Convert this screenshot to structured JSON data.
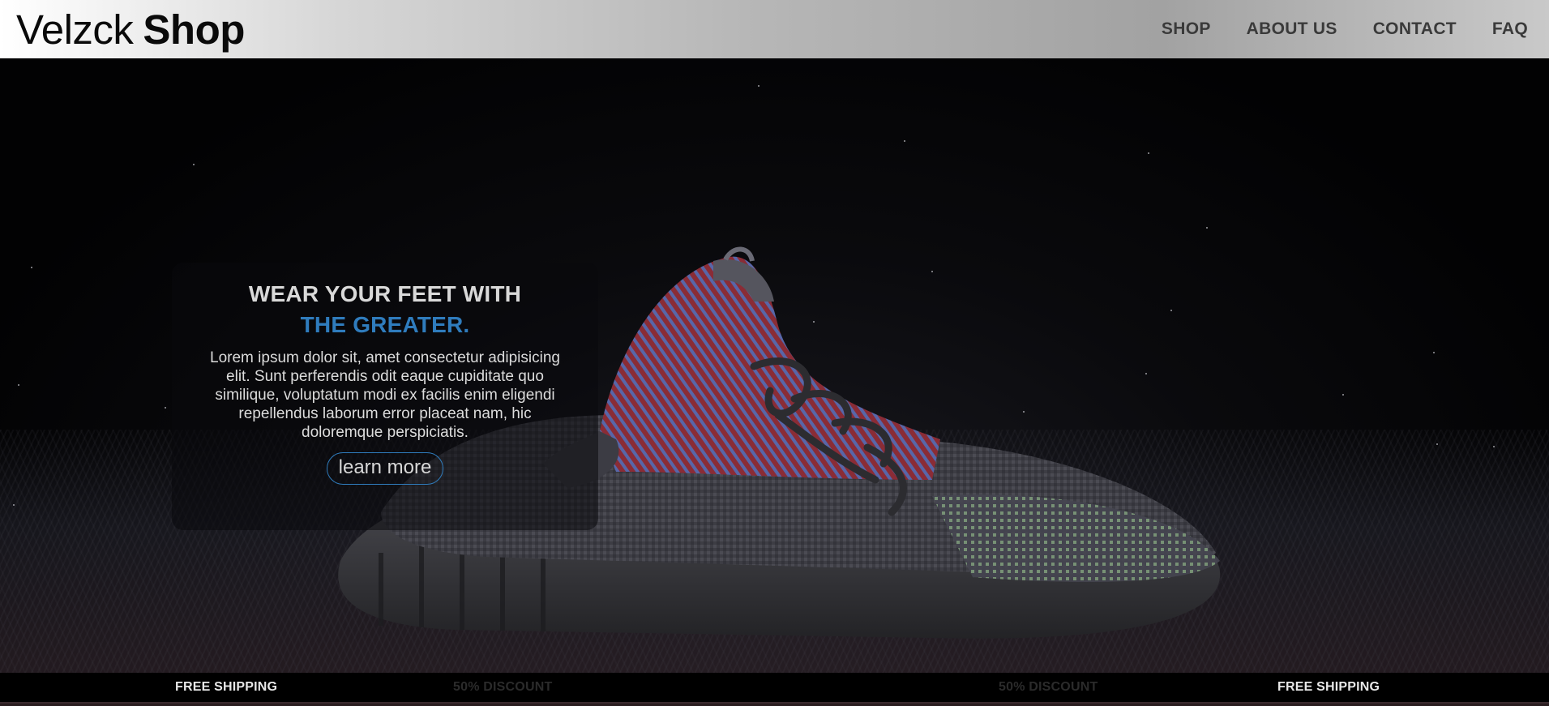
{
  "header": {
    "logo_light": "Velzck",
    "logo_bold": "Shop",
    "nav": [
      {
        "label": "SHOP"
      },
      {
        "label": "ABOUT US"
      },
      {
        "label": "CONTACT"
      },
      {
        "label": "FAQ"
      }
    ]
  },
  "hero": {
    "headline_line1": "WEAR YOUR FEET WITH",
    "headline_line2": "THE GREATER.",
    "body": "Lorem ipsum dolor sit, amet consectetur adipisicing elit. Sunt perferendis odit eaque cupiditate quo similique, voluptatum modi ex facilis enim eligendi repellendus laborum error placeat nam, hic doloremque perspiciatis.",
    "cta_label": "learn more",
    "accent_color": "#2f7cbd"
  },
  "ticker": {
    "items": [
      {
        "label": "FREE SHIPPING",
        "style": "on"
      },
      {
        "label": "50% DISCOUNT",
        "style": "dim"
      },
      {
        "label": "50% DISCOUNT",
        "style": "dim"
      },
      {
        "label": "FREE SHIPPING",
        "style": "on"
      }
    ]
  }
}
